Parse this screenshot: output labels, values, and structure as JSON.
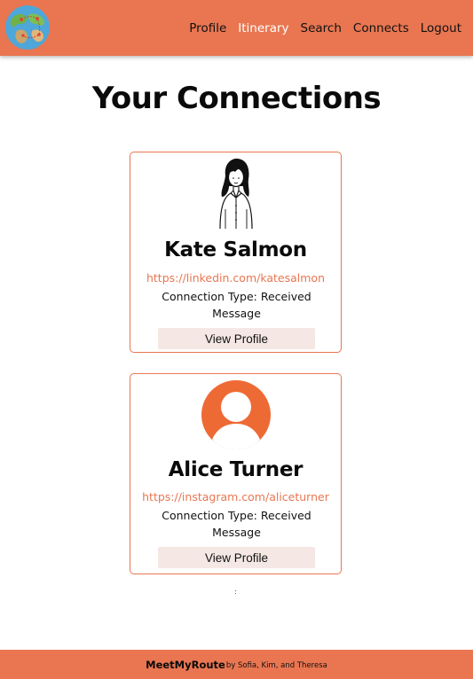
{
  "nav": {
    "logo_icon": "globe-icon",
    "links": [
      "Profile",
      "Itinerary",
      "Search",
      "Connects",
      "Logout"
    ],
    "active_link": "Itinerary"
  },
  "page": {
    "title": "Your Connections"
  },
  "connections": [
    {
      "name": "Kate Salmon",
      "link": "https://linkedin.com/katesalmon",
      "connection_type": "Connection Type: Received Message",
      "button_label": "View Profile",
      "avatar_icon": "woman-illustration-icon"
    },
    {
      "name": "Alice Turner",
      "link": "https://instagram.com/aliceturner",
      "connection_type": "Connection Type: Received Message",
      "button_label": "View Profile",
      "avatar_icon": "default-user-icon"
    }
  ],
  "stray_text": ":",
  "footer": {
    "brand": "MeetMyRoute",
    "credit": "by Sofia, Kim, and Theresa"
  },
  "colors": {
    "accent": "#e97651",
    "button_bg": "#f5e8e4",
    "active_nav": "#ffffff",
    "avatar_orange": "#ee6a35"
  }
}
